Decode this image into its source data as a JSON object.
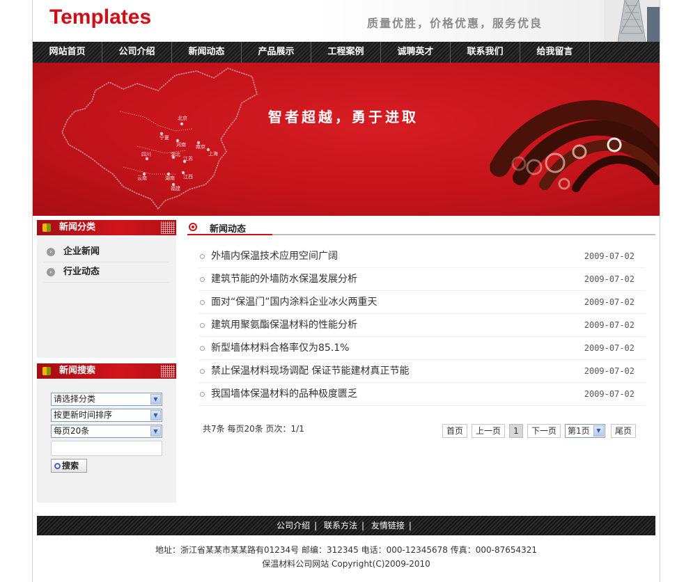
{
  "header": {
    "logo": "Templates",
    "slogan": "质量优胜，价格优惠，服务优良"
  },
  "nav": {
    "items": [
      "网站首页",
      "公司介绍",
      "新闻动态",
      "产品展示",
      "工程案例",
      "诚聘英才",
      "联系我们",
      "给我留言"
    ]
  },
  "banner": {
    "tagline": "智者超越，勇于进取",
    "map_cities": [
      "北京",
      "宁夏",
      "河南",
      "南京",
      "上海",
      "四川",
      "湖北",
      "江苏",
      "云南",
      "湖南",
      "江西",
      "福建"
    ]
  },
  "sidebar": {
    "categories_title": "新闻分类",
    "categories": [
      "企业新闻",
      "行业动态"
    ],
    "search_title": "新闻搜索",
    "select_category": "请选择分类",
    "select_sort": "按更新时间排序",
    "select_pagesize": "每页20条",
    "search_button": "搜索"
  },
  "main": {
    "title": "新闻动态",
    "news": [
      {
        "title": "外墙内保温技术应用空间广阔",
        "date": "2009-07-02"
      },
      {
        "title": "建筑节能的外墙防水保温发展分析",
        "date": "2009-07-02"
      },
      {
        "title": "面对“保温门”国内涂料企业冰火两重天",
        "date": "2009-07-02"
      },
      {
        "title": "建筑用聚氨酯保温材料的性能分析",
        "date": "2009-07-02"
      },
      {
        "title": "新型墙体材料合格率仅为85.1%",
        "date": "2009-07-02"
      },
      {
        "title": "禁止保温材料现场调配 保证节能建材真正节能",
        "date": "2009-07-02"
      },
      {
        "title": "我国墙体保温材料的品种极度匮乏",
        "date": "2009-07-02"
      }
    ],
    "pager": {
      "info": "共7条  每页20条  页次：1/1",
      "first": "首页",
      "prev": "上一页",
      "current": "1",
      "next": "下一页",
      "page_select": "第1页",
      "last": "尾页"
    }
  },
  "footer": {
    "links": [
      "公司介绍",
      "联系方法",
      "友情链接"
    ],
    "address_line": "地址：浙江省某某市某某路有01234号 邮编：312345 电话：000-12345678 传真：000-87654321",
    "copyright_line": "保温材料公司网站  Copyright(C)2009-2010"
  },
  "colors": {
    "brand_red": "#cc1019",
    "nav_dark": "#1d1d1d"
  }
}
